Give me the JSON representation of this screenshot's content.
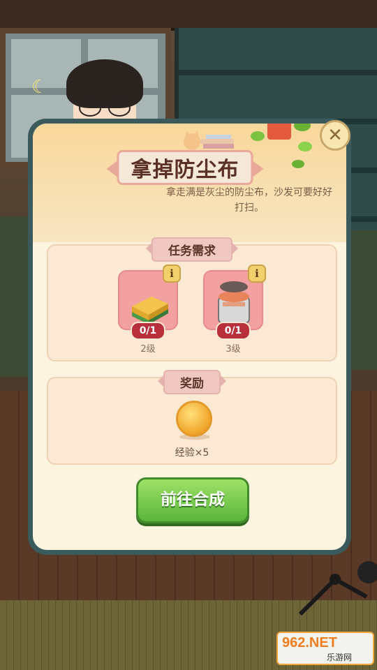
{
  "modal": {
    "title": "拿掉防尘布",
    "description": "拿走满是灰尘的防尘布，沙发可要好好打扫。",
    "close_glyph": "✕"
  },
  "requirements": {
    "label": "任务需求",
    "items": [
      {
        "icon": "sponge-icon",
        "count": "0/1",
        "level": "2级",
        "info": "i"
      },
      {
        "icon": "trash-can-icon",
        "count": "0/1",
        "level": "3级",
        "info": "i"
      }
    ]
  },
  "rewards": {
    "label": "奖励",
    "item": {
      "icon": "coin-icon",
      "label": "经验×5"
    }
  },
  "action_button": {
    "label": "前往合成"
  },
  "watermark": {
    "main": "962.NET",
    "sub": "乐游网"
  },
  "colors": {
    "panel_frame": "#3a5a5c",
    "panel_bg": "#fdf4df",
    "card_pink": "#f3a0a0",
    "count_red": "#b8303b",
    "button_green": "#59b53a"
  }
}
